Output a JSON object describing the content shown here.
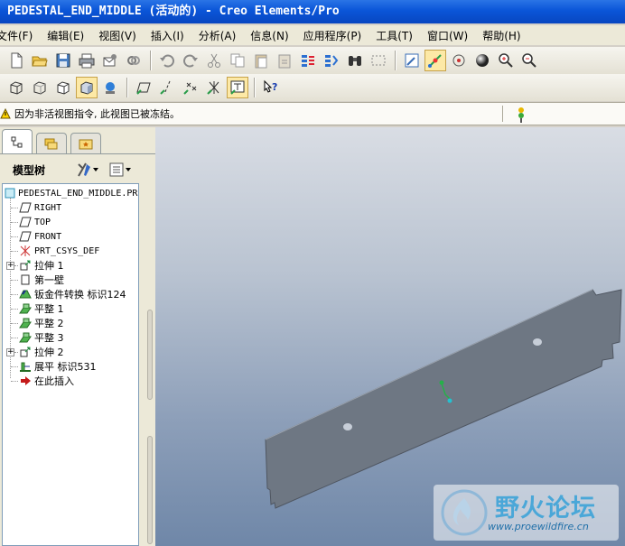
{
  "window": {
    "title": "PEDESTAL_END_MIDDLE (活动的) - Creo Elements/Pro"
  },
  "menu": {
    "items": [
      "文件(F)",
      "编辑(E)",
      "视图(V)",
      "插入(I)",
      "分析(A)",
      "信息(N)",
      "应用程序(P)",
      "工具(T)",
      "窗口(W)",
      "帮助(H)"
    ]
  },
  "message": {
    "text": "因为非活视图指令, 此视图已被冻结。"
  },
  "model_tree": {
    "title": "模型树",
    "root": "PEDESTAL_END_MIDDLE.PR",
    "items": [
      {
        "label": "RIGHT",
        "icon": "datum-plane-icon",
        "mono": true
      },
      {
        "label": "TOP",
        "icon": "datum-plane-icon",
        "mono": true
      },
      {
        "label": "FRONT",
        "icon": "datum-plane-icon",
        "mono": true
      },
      {
        "label": "PRT_CSYS_DEF",
        "icon": "csys-icon",
        "mono": true
      },
      {
        "label": "拉伸 1",
        "icon": "extrude-icon",
        "expandable": true
      },
      {
        "label": "第一壁",
        "icon": "wall-icon"
      },
      {
        "label": "钣金件转换 标识124",
        "icon": "convert-icon"
      },
      {
        "label": "平整 1",
        "icon": "flat-icon"
      },
      {
        "label": "平整 2",
        "icon": "flat-icon"
      },
      {
        "label": "平整 3",
        "icon": "flat-icon"
      },
      {
        "label": "拉伸 2",
        "icon": "extrude-icon",
        "expandable": true
      },
      {
        "label": "展平 标识531",
        "icon": "unbend-icon"
      },
      {
        "label": "在此插入",
        "icon": "insert-here-icon"
      }
    ]
  },
  "watermark": {
    "cn": "野火论坛",
    "url": "www.proewildfire.cn"
  },
  "colors": {
    "titlebar": "#0a55d8",
    "model": "#6e7783",
    "viewport_top": "#d9dde4",
    "viewport_bottom": "#6f87a8"
  }
}
